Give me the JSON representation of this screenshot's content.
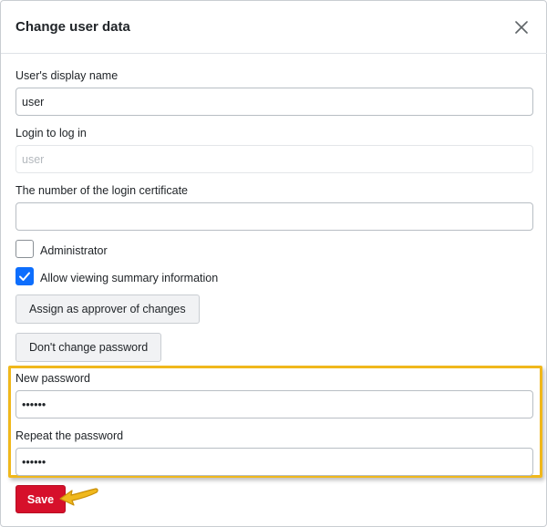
{
  "dialog": {
    "title": "Change user data",
    "close_icon": "close-icon"
  },
  "fields": {
    "display_name": {
      "label": "User's display name",
      "value": "user"
    },
    "login": {
      "label": "Login to log in",
      "value": "",
      "placeholder": "user"
    },
    "certificate": {
      "label": "The number of the login certificate",
      "value": ""
    }
  },
  "checkboxes": {
    "administrator": {
      "label": "Administrator",
      "checked": false
    },
    "summary": {
      "label": "Allow viewing summary information",
      "checked": true
    }
  },
  "buttons": {
    "approver": "Assign as approver of changes",
    "dont_change_password": "Don't change password",
    "save": "Save"
  },
  "password": {
    "new_label": "New password",
    "new_value": "••••••",
    "repeat_label": "Repeat the password",
    "repeat_value": "••••••"
  },
  "colors": {
    "highlight": "#f0b81c",
    "save_button": "#d6102b",
    "checkbox_checked": "#0d6efd"
  },
  "annotations": {
    "pointer_icon": "pointing-arrow-icon"
  }
}
